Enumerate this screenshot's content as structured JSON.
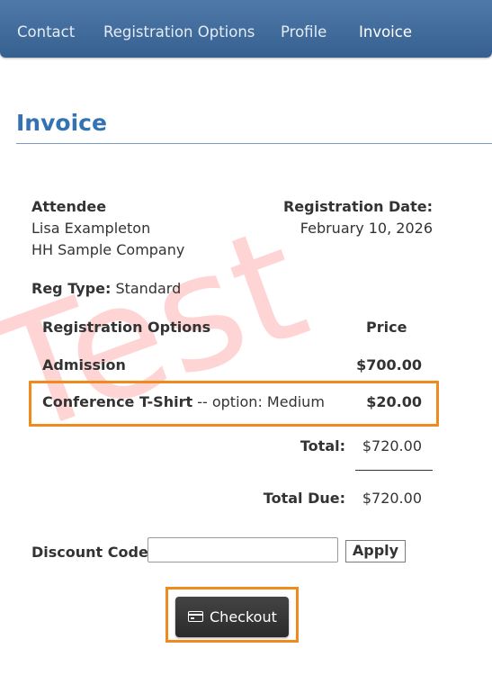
{
  "nav": {
    "items": [
      {
        "label": "Contact"
      },
      {
        "label": "Registration Options"
      },
      {
        "label": "Profile"
      },
      {
        "label": "Invoice",
        "active": true
      }
    ]
  },
  "page_title": "Invoice",
  "watermark": "Test",
  "attendee": {
    "heading": "Attendee",
    "name": "Lisa Exampleton",
    "company": "HH Sample Company"
  },
  "registration_date": {
    "heading": "Registration Date:",
    "value": "February 10, 2026"
  },
  "reg_type": {
    "label": "Reg Type:",
    "value": "Standard"
  },
  "options_table": {
    "headers": {
      "item": "Registration Options",
      "price": "Price"
    },
    "rows": [
      {
        "name": "Admission",
        "option": "",
        "price": "$700.00"
      },
      {
        "name": "Conference T-Shirt",
        "option": "-- option: Medium",
        "price": "$20.00"
      }
    ]
  },
  "total": {
    "label": "Total:",
    "value": "$720.00"
  },
  "total_due": {
    "label": "Total Due:",
    "value": "$720.00"
  },
  "discount": {
    "label": "Discount Code:",
    "value": "",
    "apply_label": "Apply"
  },
  "checkout": {
    "label": "Checkout"
  },
  "colors": {
    "nav_bg": "#3f6a9a",
    "title": "#3372b3",
    "highlight": "#f08a1c",
    "watermark": "#ff7878",
    "checkout_bg": "#333333"
  }
}
